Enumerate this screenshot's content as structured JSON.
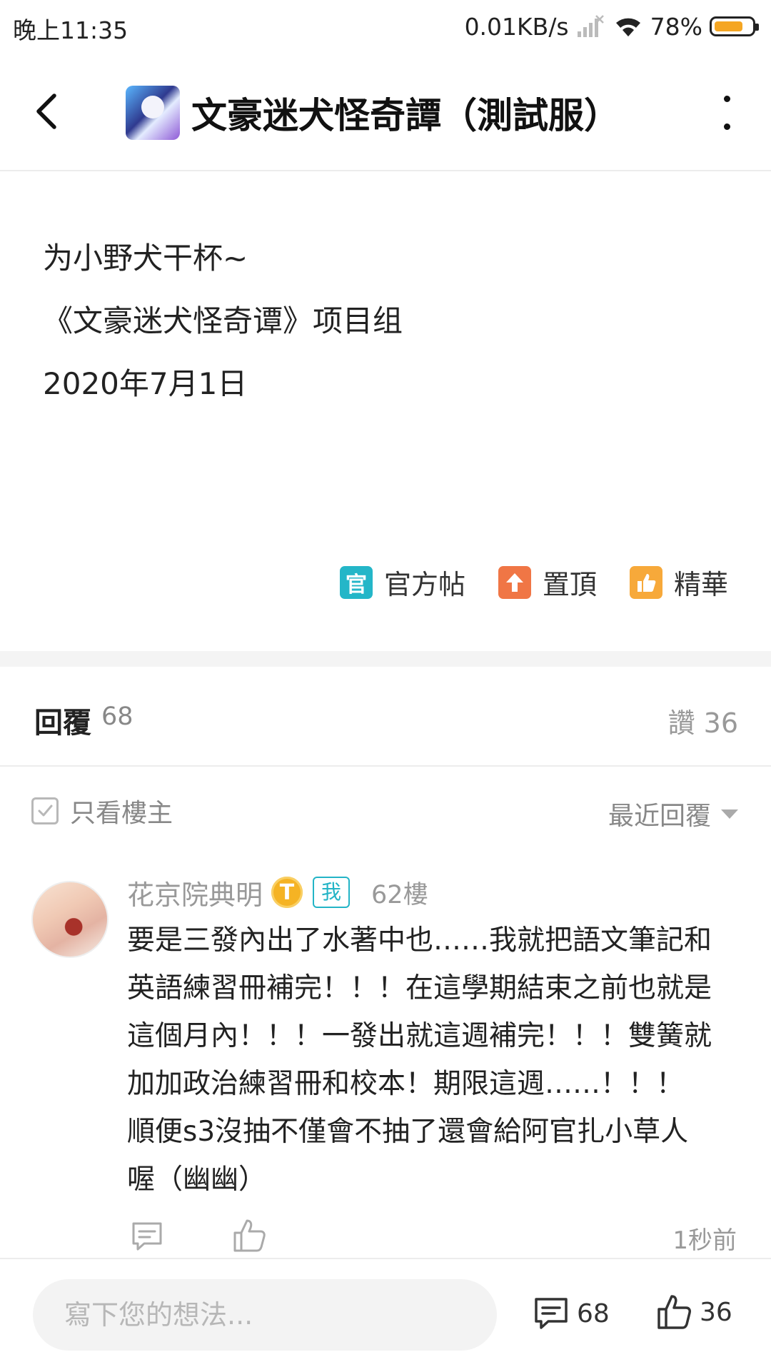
{
  "status_bar": {
    "time": "晚上11:35",
    "network_speed": "0.01KB/s",
    "battery_percent": "78%",
    "battery_level": 0.78,
    "icons": [
      "signal-icon",
      "wifi-icon",
      "battery-icon"
    ]
  },
  "header": {
    "title": "文豪迷犬怪奇譚（測試服）",
    "back_icon": "back-arrow-icon",
    "more_icon": "more-vertical-icon"
  },
  "post": {
    "lines": [
      "为小野犬干杯~",
      "《文豪迷犬怪奇谭》项目组",
      "2020年7月1日"
    ],
    "tags": [
      {
        "badge": "官",
        "label": "官方帖",
        "color": "#24b6c8"
      },
      {
        "badge": "⇧",
        "label": "置頂",
        "color": "#f07645"
      },
      {
        "badge": "👍",
        "label": "精華",
        "color": "#f7a93a"
      }
    ]
  },
  "replies_header": {
    "title": "回覆",
    "count": "68",
    "likes_label": "讚 36"
  },
  "filter": {
    "op_only_label": "只看樓主",
    "sort_label": "最近回覆"
  },
  "comment": {
    "username": "花京院典明",
    "level_badge": "T",
    "me_badge": "我",
    "floor": "62樓",
    "lines": [
      "要是三發內出了水著中也……我就把語文筆記和",
      "英語練習冊補完！！！在這學期結束之前也就是",
      "這個月內！！！一發出就這週補完！！！雙簧就",
      "加加政治練習冊和校本！期限這週……！！！",
      "順便s3沒抽不僅會不抽了還會給阿官扎小草人",
      "喔（幽幽）"
    ],
    "time": "1秒前"
  },
  "bottom_bar": {
    "input_placeholder": "寫下您的想法...",
    "comment_count": "68",
    "like_count": "36"
  },
  "colors": {
    "accent_teal": "#24b6c8",
    "pinned_orange": "#f07645",
    "featured_yellow": "#f7a93a",
    "level_gold": "#f5b324"
  }
}
